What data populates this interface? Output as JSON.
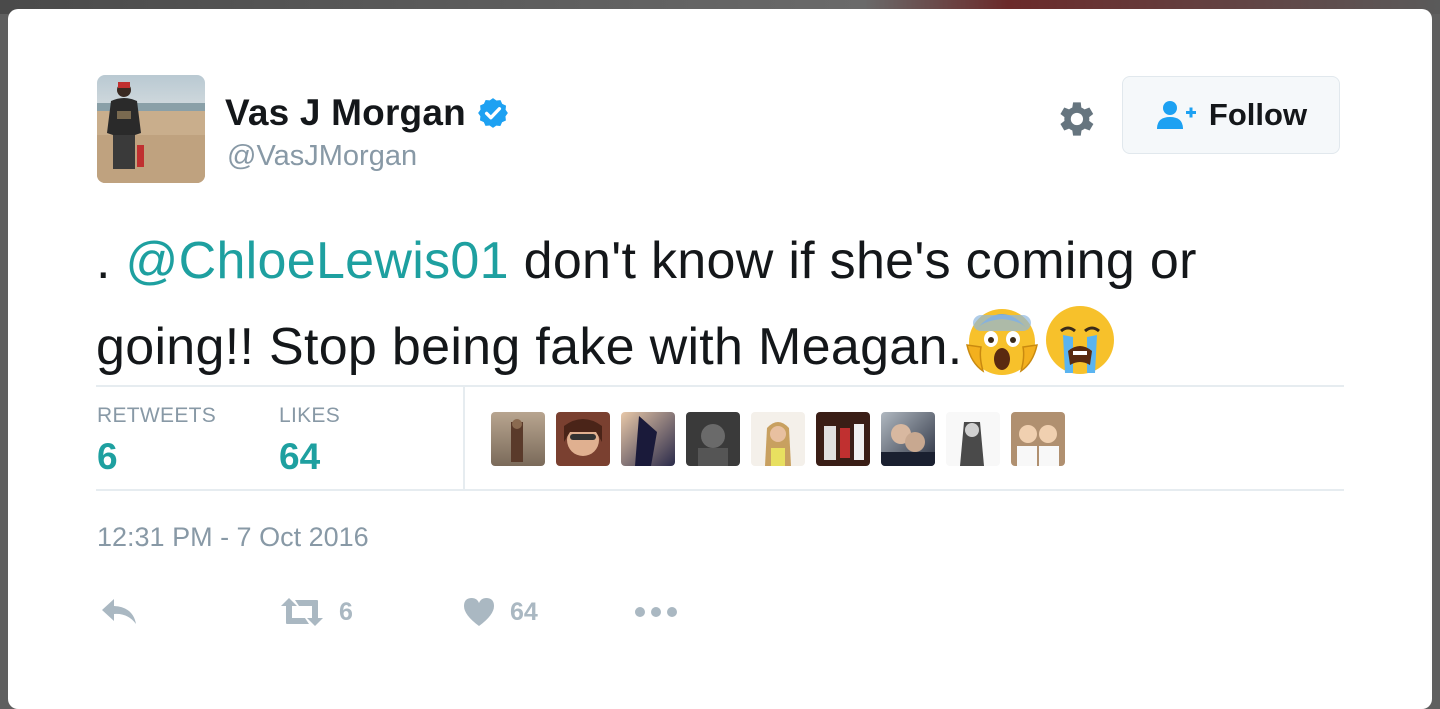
{
  "tweet": {
    "author": {
      "name": "Vas J Morgan",
      "handle": "@VasJMorgan",
      "verified": true,
      "avatar_icon": "profile-photo"
    },
    "follow_label": "Follow",
    "settings_icon": "gear-icon",
    "text_prefix": ".",
    "mention": "@ChloeLewis01",
    "text_line": "don't know if she's coming or going!! Stop being fake with Meagan.",
    "emojis": [
      "face-screaming-in-fear",
      "loudly-crying-face"
    ],
    "stats": {
      "retweets_label": "RETWEETS",
      "retweets_value": "6",
      "likes_label": "LIKES",
      "likes_value": "64"
    },
    "liker_avatars_count": 9,
    "timestamp": "12:31 PM - 7 Oct 2016",
    "actions": {
      "reply_icon": "reply-icon",
      "retweet_count": "6",
      "like_count": "64",
      "more_icon": "more-icon"
    }
  },
  "colors": {
    "accent": "#1ea0a0",
    "verified": "#1da1f2",
    "text": "#14171a",
    "muted": "#8899a6"
  }
}
